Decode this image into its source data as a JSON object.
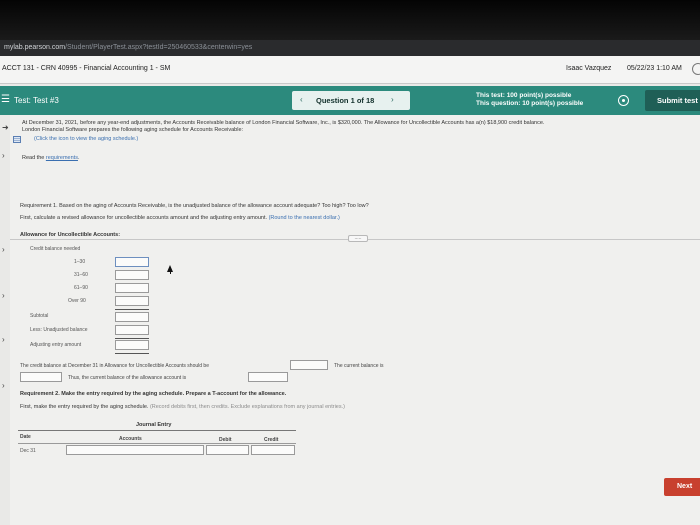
{
  "browser": {
    "url_host": "mylab.pearson.com",
    "url_path": "/Student/PlayerTest.aspx?testId=250460533&centerwin=yes"
  },
  "appbar": {
    "course_title": "ACCT 131 - CRN 40995 - Financial Accounting 1 - SM",
    "user_name": "Isaac Vazquez",
    "datetime": "05/22/23 1:10 AM"
  },
  "testbar": {
    "test_title": "Test: Test #3",
    "question_label": "Question 1 of 18",
    "test_points": "This test: 100 point(s) possible",
    "question_points": "This question: 10 point(s) possible",
    "submit_label": "Submit test",
    "color": "#2c8a7d"
  },
  "problem": {
    "intro_line1": "At December 31, 2021, before any year-end adjustments, the Accounts Receivable balance of London Financial Software, Inc., is $320,000. The Allowance for Uncollectible Accounts has a(n) $18,900 credit balance.",
    "intro_line2": "London Financial Software prepares the following aging schedule for Accounts Receivable:",
    "aging_link": "(Click the icon to view the aging schedule.)",
    "read_prefix": "Read the",
    "requirements_link": "requirements",
    "more_label": "....."
  },
  "requirement1": {
    "text": "Requirement 1. Based on the aging of Accounts Receivable, is the unadjusted balance of the allowance account adequate? Too high? Too low?",
    "instruction": "First, calculate a revised allowance for uncollectible accounts amount and the adjusting entry amount.",
    "instruction_hint": "(Round to the nearest dollar.)",
    "allowance_heading": "Allowance for Uncollectible Accounts:",
    "credit_balance_needed": "Credit balance needed",
    "rows": [
      "1–30",
      "31–60",
      "61–90",
      "Over 90"
    ],
    "subtotal": "Subtotal",
    "less_unadjusted": "Less: Unadjusted balance",
    "adjusting_entry": "Adjusting entry amount",
    "credit_balance_sentence": "The credit balance at December 31 in Allowance for Uncollectible Accounts should be",
    "current_balance_is": "The current balance is",
    "thus_sentence": "Thus, the current balance of the allowance account is"
  },
  "requirement2": {
    "text": "Requirement 2. Make the entry required by the aging schedule. Prepare a T-account for the allowance.",
    "instruction": "First, make the entry required by the aging schedule.",
    "instruction_hint": "(Record debits first, then credits. Exclude explanations from any journal entries.)",
    "journal_title": "Journal Entry",
    "columns": {
      "date": "Date",
      "accounts": "Accounts",
      "debit": "Debit",
      "credit": "Credit"
    },
    "row_date": "Dec 31"
  },
  "footer": {
    "next_label": "Next",
    "next_color": "#c8402e"
  }
}
